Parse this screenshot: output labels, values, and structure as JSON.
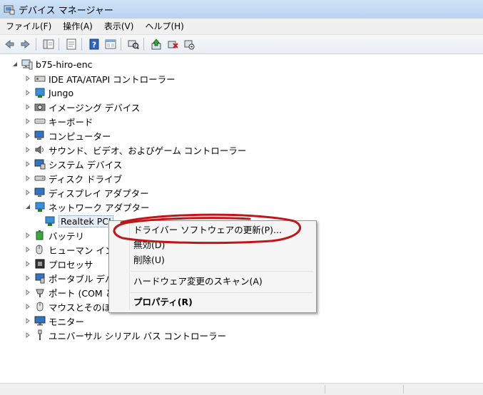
{
  "window": {
    "title": "デバイス マネージャー"
  },
  "menubar": {
    "items": [
      "ファイル(F)",
      "操作(A)",
      "表示(V)",
      "ヘルプ(H)"
    ]
  },
  "toolbar": {
    "buttons": [
      "back-arrow-icon",
      "forward-arrow-icon",
      "show-hide-tree-icon",
      "properties-icon",
      "help-icon",
      "action-view-icon",
      "scan-hardware-icon",
      "update-driver-icon",
      "uninstall-icon",
      "disable-device-icon"
    ]
  },
  "tree": {
    "root": "b75-hiro-enc",
    "nodes": [
      "IDE ATA/ATAPI コントローラー",
      "Jungo",
      "イメージング デバイス",
      "キーボード",
      "コンピューター",
      "サウンド、ビデオ、およびゲーム コントローラー",
      "システム デバイス",
      "ディスク ドライブ",
      "ディスプレイ アダプター",
      "ネットワーク アダプター",
      "Realtek PCI",
      "バッテリ",
      "ヒューマン イン",
      "プロセッサ",
      "ポータブル デバ",
      "ポート (COM と",
      "マウスとそのほ",
      "モニター",
      "ユニバーサル シリアル バス コントローラー"
    ]
  },
  "context_menu": {
    "items": {
      "update_driver": "ドライバー ソフトウェアの更新(P)...",
      "disable": "無効(D)",
      "uninstall": "削除(U)",
      "scan": "ハードウェア変更のスキャン(A)",
      "properties": "プロパティ(R)"
    }
  },
  "colors": {
    "titlebar": "#c4dbf3",
    "annotation_red": "#c0161a",
    "menu_bg": "#f5f5f5"
  }
}
